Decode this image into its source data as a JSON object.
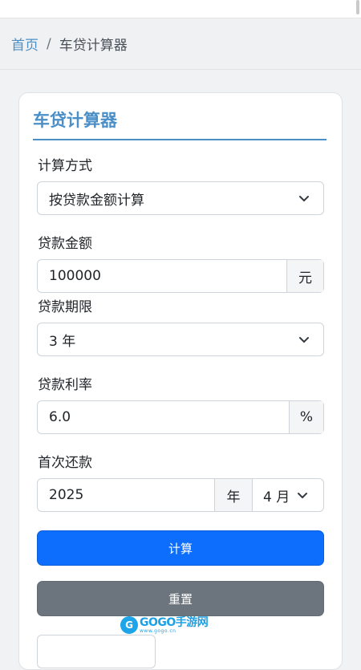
{
  "breadcrumb": {
    "home": "首页",
    "separator": "/",
    "current": "车贷计算器"
  },
  "card": {
    "title": "车贷计算器"
  },
  "form": {
    "method": {
      "label": "计算方式",
      "value": "按贷款金额计算"
    },
    "amount": {
      "label": "贷款金额",
      "value": "100000",
      "unit": "元"
    },
    "term": {
      "label": "贷款期限",
      "value": "3 年"
    },
    "rate": {
      "label": "贷款利率",
      "value": "6.0",
      "unit": "%"
    },
    "first_payment": {
      "label": "首次还款",
      "year": "2025",
      "year_unit": "年",
      "month": "4 月"
    }
  },
  "buttons": {
    "calculate": "计算",
    "reset": "重置"
  },
  "watermark": {
    "logo_letter": "G",
    "text": "GOGO手游网",
    "sub": "www.gogo.cn"
  },
  "icons": {
    "chevron": "chevron-down-icon"
  },
  "colors": {
    "accent": "#4a8fc7",
    "primary": "#0d6efd",
    "secondary": "#6c757d"
  }
}
